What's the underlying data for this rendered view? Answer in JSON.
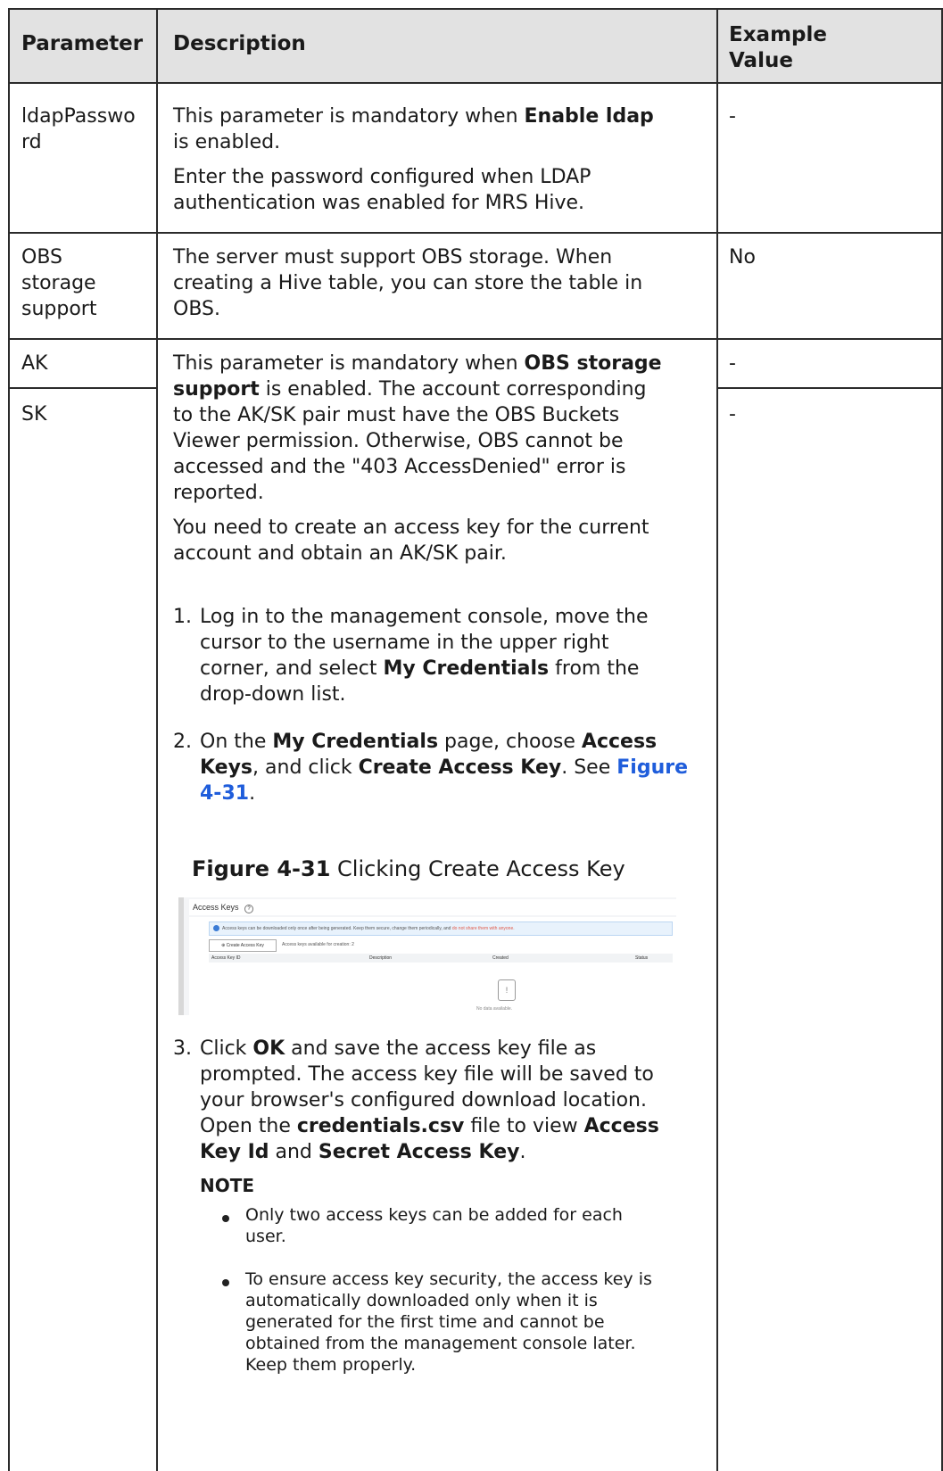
{
  "headers": {
    "parameter": "Parameter",
    "description": "Description",
    "example_line1": "Example",
    "example_line2": "Value"
  },
  "rows": {
    "ldap": {
      "param_line1": "ldapPasswo",
      "param_line2": "rd",
      "desc1_line1_pre": "This parameter is mandatory when ",
      "desc1_line1_bold": "Enable ldap",
      "desc1_line2": "is enabled.",
      "desc2_line1": "Enter the password configured when LDAP",
      "desc2_line2": "authentication was enabled for MRS Hive.",
      "example": "-"
    },
    "obs": {
      "param_line1": "OBS",
      "param_line2": "storage",
      "param_line3": "support",
      "desc_line1": "The server must support OBS storage. When",
      "desc_line2": "creating a Hive table, you can store the table in",
      "desc_line3": "OBS.",
      "example": "No"
    },
    "ak": {
      "param": "AK",
      "example": "-"
    },
    "sk": {
      "param": "SK",
      "example": "-"
    }
  },
  "aksk": {
    "p1_l1_pre": "This parameter is mandatory when ",
    "p1_l1_bold": "OBS storage",
    "p1_l2_bold": "support",
    "p1_l2_rest": " is enabled. The account corresponding",
    "p1_l3": "to the AK/SK pair must have the OBS Buckets",
    "p1_l4": "Viewer permission. Otherwise, OBS cannot be",
    "p1_l5": "accessed and the \"403 AccessDenied\" error is",
    "p1_l6": "reported.",
    "p2_l1": "You need to create an access key for the current",
    "p2_l2": "account and obtain an AK/SK pair.",
    "s1_num": "1.",
    "s1_l1": "Log in to the management console, move the",
    "s1_l2": "cursor to the username in the upper right",
    "s1_l3_pre": "corner, and select ",
    "s1_l3_bold": "My Credentials",
    "s1_l3_post": " from the",
    "s1_l4": "drop-down list.",
    "s2_num": "2.",
    "s2_l1_pre": "On the ",
    "s2_l1_b1": "My Credentials",
    "s2_l1_mid": " page, choose ",
    "s2_l1_b2": "Access",
    "s2_l2_b1": "Keys",
    "s2_l2_mid": ", and click ",
    "s2_l2_b2": "Create Access Key",
    "s2_l2_post": ". See ",
    "s2_l2_link": "Figure",
    "s2_l3_link": "4-31",
    "s2_l3_post": ".",
    "fig_label": "Figure 4-31",
    "fig_caption": " Clicking Create Access Key",
    "s3_num": "3.",
    "s3_l1_pre": "Click ",
    "s3_l1_bold": "OK",
    "s3_l1_post": " and save the access key file as",
    "s3_l2": "prompted. The access key file will be saved to",
    "s3_l3": "your browser's configured download location.",
    "s3_l4_pre": "Open the ",
    "s3_l4_bold1": "credentials.csv",
    "s3_l4_mid": " file to view ",
    "s3_l4_bold2": "Access",
    "s3_l5_bold1": "Key Id",
    "s3_l5_mid": " and ",
    "s3_l5_bold2": "Secret Access Key",
    "s3_l5_post": ".",
    "note_title": "NOTE",
    "n1_l1": "Only two access keys can be added for each",
    "n1_l2": "user.",
    "n2_l1": "To ensure access key security, the access key is",
    "n2_l2": "automatically downloaded only when it is",
    "n2_l3": "generated for the first time and cannot be",
    "n2_l4": "obtained from the management console later.",
    "n2_l5": "Keep them properly."
  },
  "screenshot": {
    "title": "Access Keys",
    "help_icon": "question-circle-icon",
    "info_text": "Access keys can be downloaded only once after being generated. Keep them secure, change them periodically, and ",
    "info_red": "do not share them with anyone.",
    "create_btn": "Create Access Key",
    "available": "Access keys available for creation: 2",
    "col_id": "Access Key ID",
    "col_desc": "Description",
    "col_created": "Created",
    "col_status": "Status",
    "empty_text": "No data available."
  }
}
